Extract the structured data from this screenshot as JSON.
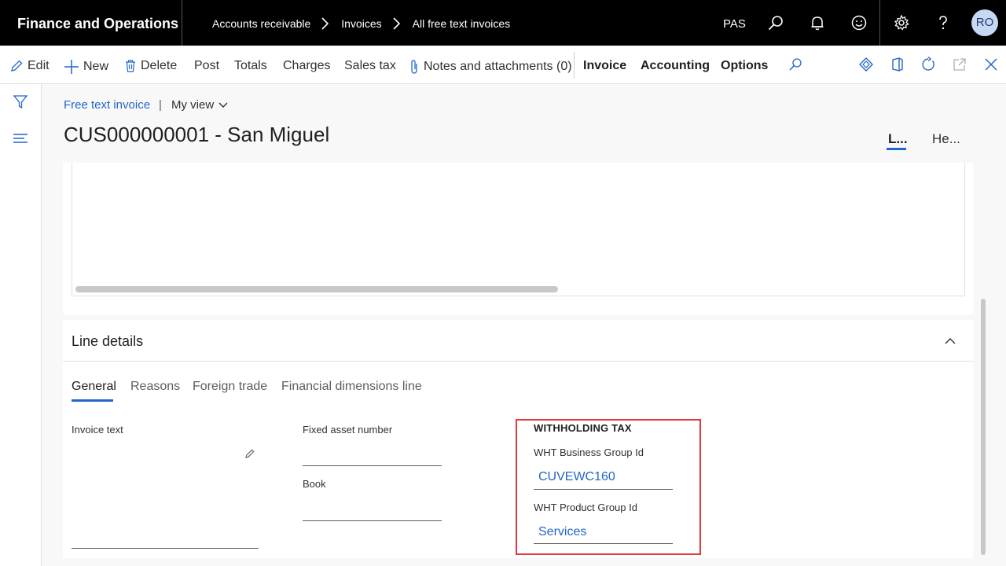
{
  "topbar": {
    "app_title": "Finance and Operations",
    "breadcrumbs": [
      "Accounts receivable",
      "Invoices",
      "All free text invoices"
    ],
    "company": "PAS",
    "avatar_initials": "RO",
    "icons": [
      "search-icon",
      "bell-icon",
      "smiley-icon",
      "gear-icon",
      "help-icon"
    ]
  },
  "actionpane": {
    "edit": "Edit",
    "new": "New",
    "delete": "Delete",
    "post": "Post",
    "totals": "Totals",
    "charges": "Charges",
    "sales_tax": "Sales tax",
    "notes": "Notes and attachments (0)",
    "invoice": "Invoice",
    "accounting": "Accounting",
    "options": "Options"
  },
  "header": {
    "form_link": "Free text invoice",
    "pipe": "|",
    "view": "My view",
    "record_title": "CUS000000001 - San Miguel",
    "tab_lines": "L...",
    "tab_header": "He..."
  },
  "line_details": {
    "title": "Line details",
    "tabs": [
      "General",
      "Reasons",
      "Foreign trade",
      "Financial dimensions line"
    ],
    "fields": {
      "invoice_text_label": "Invoice text",
      "fixed_asset_label": "Fixed asset number",
      "book_label": "Book",
      "wht_section": "WITHHOLDING TAX",
      "wht_business_label": "WHT Business Group Id",
      "wht_business_value": "CUVEWC160",
      "wht_product_label": "WHT Product Group Id",
      "wht_product_value": "Services"
    }
  },
  "colors": {
    "accent": "#2266c7",
    "highlight": "#e0393e",
    "topbar": "#000000"
  }
}
